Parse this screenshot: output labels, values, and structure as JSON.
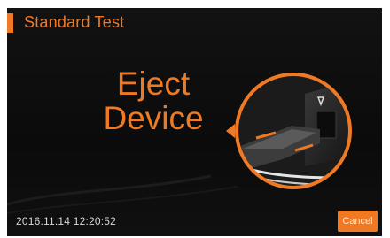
{
  "header": {
    "title": "Standard Test"
  },
  "main": {
    "message_line1": "Eject",
    "message_line2": "Device"
  },
  "footer": {
    "datetime": "2016.11.14   12:20:52",
    "cancel_label": "Cancel"
  },
  "colors": {
    "accent": "#f07a24",
    "background": "#0f0f0f",
    "datetime_text": "#d8d8d8"
  },
  "icons": {
    "illustration": "device-eject-illustration",
    "pointer": "pointer-triangle-icon"
  }
}
